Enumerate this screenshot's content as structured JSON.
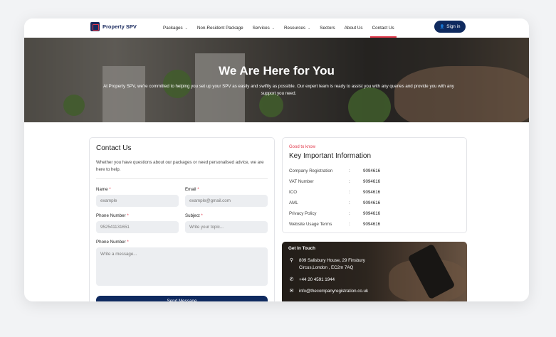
{
  "brand": {
    "name": "Property SPV"
  },
  "nav": {
    "items": [
      {
        "label": "Packages",
        "has_dropdown": true
      },
      {
        "label": "Non-Resident Package",
        "has_dropdown": false
      },
      {
        "label": "Services",
        "has_dropdown": true
      },
      {
        "label": "Resources",
        "has_dropdown": true
      },
      {
        "label": "Sectors",
        "has_dropdown": false
      },
      {
        "label": "About Us",
        "has_dropdown": false
      },
      {
        "label": "Contact Us",
        "has_dropdown": false,
        "active": true
      }
    ],
    "signin_label": "Sign in"
  },
  "hero": {
    "title": "We Are Here for You",
    "subtitle": "At Property SPV, we're committed to helping you set up your SPV as easily and swiftly as possible. Our expert team is ready to assist you with any queries and provide you with any support you need."
  },
  "contact": {
    "title": "Contact Us",
    "intro": "Whether you have questions about our packages or need personalised advice, we are here to help.",
    "fields": {
      "name": {
        "label": "Name",
        "placeholder": "example"
      },
      "email": {
        "label": "Email",
        "placeholder": "example@gmail.com"
      },
      "phone": {
        "label": "Phone Number",
        "value": "952541131651"
      },
      "subject": {
        "label": "Subject",
        "placeholder": "Write your topic..."
      },
      "message": {
        "label": "Phone Number",
        "placeholder": "Write a message..."
      }
    },
    "required_mark": "*",
    "send_label": "Send Message"
  },
  "info": {
    "kicker": "Good to know",
    "title": "Key Important Information",
    "rows": [
      {
        "key": "Company Registration",
        "value": "9094616"
      },
      {
        "key": "VAT Number",
        "value": "9094616"
      },
      {
        "key": "ICO",
        "value": "9094616"
      },
      {
        "key": "AML",
        "value": "9094616"
      },
      {
        "key": "Privacy Policy",
        "value": "9094616"
      },
      {
        "key": "Website Usage Terms",
        "value": "9094616"
      }
    ]
  },
  "touch": {
    "title": "Get In Touch",
    "address_line1": "809 Salisbury House, 29 Finsbury",
    "address_line2": "Circus,London , EC2m 7AQ",
    "phone": "+44 20 4591 1944",
    "email": "info@thecompanyregistration.co.uk"
  },
  "colors": {
    "primary": "#0f2a5f",
    "accent": "#e23a4c"
  }
}
